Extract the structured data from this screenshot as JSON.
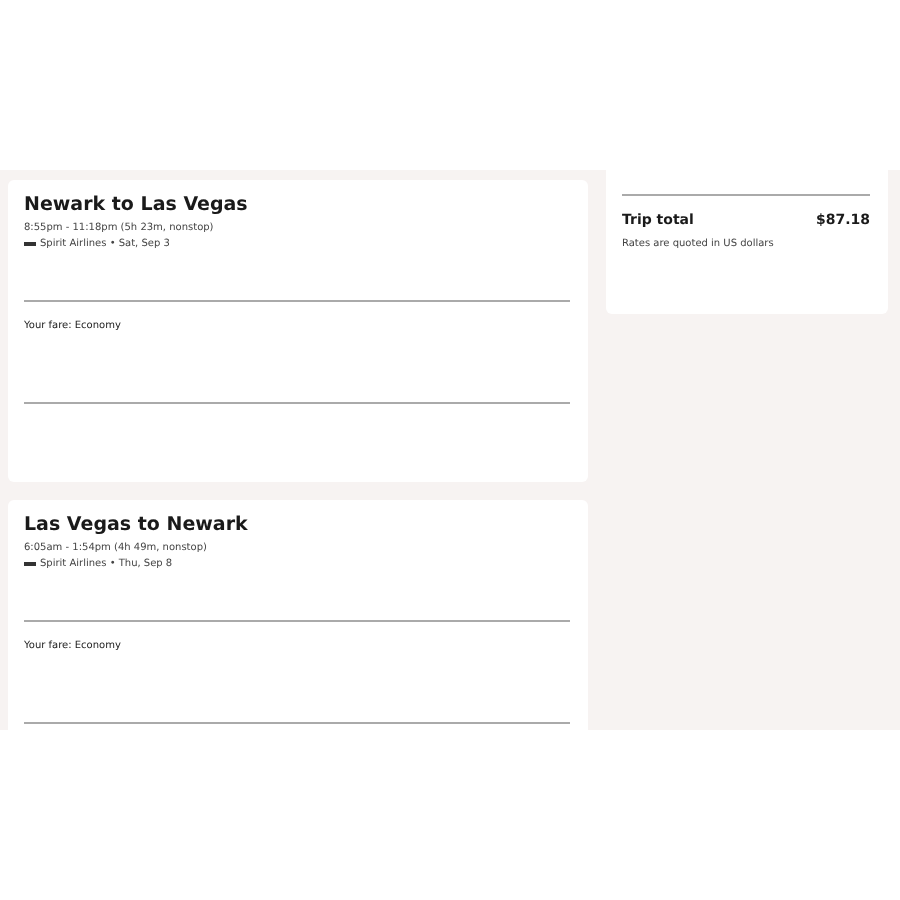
{
  "flights": [
    {
      "title": "Newark to Las Vegas",
      "times": "8:55pm - 11:18pm (5h 23m, nonstop)",
      "airline": "Spirit Airlines • Sat, Sep 3",
      "fare": "Your fare: Economy"
    },
    {
      "title": "Las Vegas to Newark",
      "times": "6:05am - 1:54pm (4h 49m, nonstop)",
      "airline": "Spirit Airlines • Thu, Sep 8",
      "fare": "Your fare: Economy"
    }
  ],
  "summary": {
    "total_label": "Trip total",
    "total": "$87.18",
    "note": "Rates are quoted in US dollars"
  }
}
